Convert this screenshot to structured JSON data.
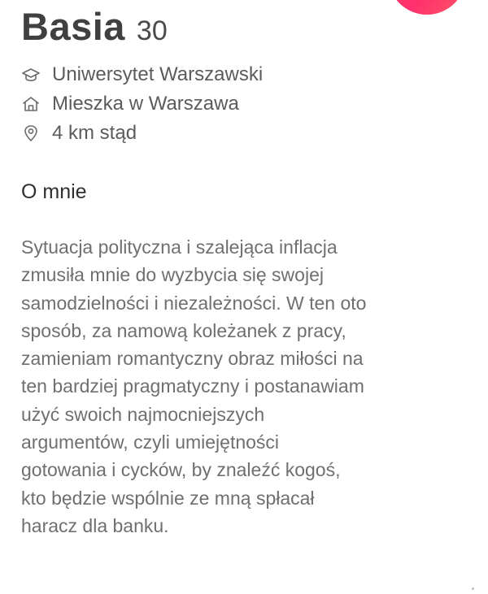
{
  "profile": {
    "name": "Basia",
    "age": "30",
    "school": "Uniwersytet Warszawski",
    "city": "Mieszka w Warszawa",
    "distance": "4 km stąd"
  },
  "icons": {
    "school": "graduation-cap-icon",
    "city": "home-icon",
    "distance": "location-pin-icon"
  },
  "about": {
    "heading": "O mnie",
    "lines": [
      "Sytuacja polityczna i szalejąca inflacja",
      "zmusiła mnie do wyzbycia się swojej",
      "samodzielności i niezależności. W ten oto",
      "sposób, za namową koleżanek z pracy,",
      "zamieniam romantyczny obraz miłości na",
      "ten bardziej pragmatyczny i postanawiam",
      "użyć swoich najmocniejszych",
      "argumentów, czyli umiejętności",
      "gotowania i cycków, by znaleźć kogoś,",
      "kto będzie wspólnie ze mną spłacał",
      "haracz dla banku."
    ]
  },
  "colors": {
    "accent": "#fd5068",
    "name": "#404040",
    "body_text": "#6f6f6f",
    "icon": "#6a6a6a"
  }
}
